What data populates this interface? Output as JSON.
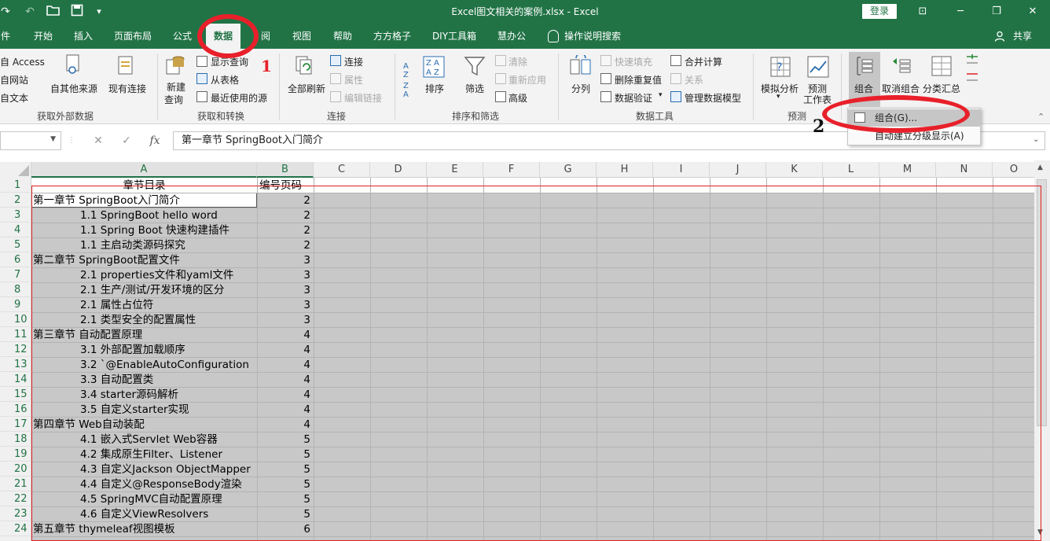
{
  "window": {
    "title": "Excel图文相关的案例.xlsx  -  Excel",
    "login_label": "登录",
    "min_glyph": "─",
    "max_glyph": "❐",
    "close_glyph": "✕",
    "ribbon_display_glyph": "⊡"
  },
  "qat": {
    "redo_glyph": "↷",
    "undo_glyph": "↶",
    "open_glyph": "▭",
    "save_glyph": "▣",
    "customize_glyph": "▾"
  },
  "tabs": [
    {
      "label": "件"
    },
    {
      "label": "开始"
    },
    {
      "label": "插入"
    },
    {
      "label": "页面布局"
    },
    {
      "label": "公式"
    },
    {
      "label": "数据"
    },
    {
      "label": "阅"
    },
    {
      "label": "视图"
    },
    {
      "label": "帮助"
    },
    {
      "label": "方方格子"
    },
    {
      "label": "DIY工具箱"
    },
    {
      "label": "慧办公"
    }
  ],
  "tell_me": "操作说明搜索",
  "share_label": "共享",
  "ribbon": {
    "get_external": {
      "from_access": "自 Access",
      "from_web": "自网站",
      "from_text": "自文本",
      "from_other": "自其他来源",
      "existing": "现有连接",
      "group": "获取外部数据"
    },
    "get_transform": {
      "new_query_1": "新建",
      "new_query_2": "查询",
      "show_queries": "显示查询",
      "from_table": "从表格",
      "recent_sources": "最近使用的源",
      "group": "获取和转换"
    },
    "connections": {
      "refresh_all": "全部刷新",
      "connections": "连接",
      "properties": "属性",
      "edit_links": "编辑链接",
      "group": "连接"
    },
    "sort_filter": {
      "sort": "排序",
      "filter": "筛选",
      "clear": "清除",
      "reapply": "重新应用",
      "advanced": "高级",
      "group": "排序和筛选"
    },
    "data_tools": {
      "split": "分列",
      "flash_fill": "快速填充",
      "remove_dup": "删除重复值",
      "validation": "数据验证",
      "consolidate": "合并计算",
      "relationships": "关系",
      "data_model": "管理数据模型",
      "group": "数据工具"
    },
    "forecast": {
      "what_if": "模拟分析",
      "forecast_sheet_1": "预测",
      "forecast_sheet_2": "工作表",
      "group": "预测"
    },
    "outline": {
      "group_btn": "组合",
      "ungroup": "取消组合",
      "subtotal": "分类汇总"
    }
  },
  "dropdown": {
    "item1": "组合(G)...",
    "item2": "自动建立分级显示(A)"
  },
  "formula_bar": {
    "cancel_glyph": "✕",
    "enter_glyph": "✓",
    "fx_glyph": "fx",
    "value": "第一章节  SpringBoot入门简介"
  },
  "columns": [
    "A",
    "B",
    "C",
    "D",
    "E",
    "F",
    "G",
    "H",
    "I",
    "J",
    "K",
    "L",
    "M",
    "N",
    "O"
  ],
  "rows": [
    {
      "n": "1",
      "a": "章节目录",
      "b": "编号页码"
    },
    {
      "n": "2",
      "a": "第一章节  SpringBoot入门简介",
      "b": "2"
    },
    {
      "n": "3",
      "a": "1.1   SpringBoot  hello word",
      "b": "2"
    },
    {
      "n": "4",
      "a": "1.1   Spring Boot 快速构建插件",
      "b": "2"
    },
    {
      "n": "5",
      "a": "1.1    主启动类源码探究",
      "b": "2"
    },
    {
      "n": "6",
      "a": "第二章节   SpringBoot配置文件",
      "b": "3"
    },
    {
      "n": "7",
      "a": "2.1    properties文件和yaml文件",
      "b": "3"
    },
    {
      "n": "8",
      "a": "2.1   生产/测试/开发环境的区分",
      "b": "3"
    },
    {
      "n": "9",
      "a": "2.1   属性占位符",
      "b": "3"
    },
    {
      "n": "10",
      "a": "2.1   类型安全的配置属性",
      "b": "3"
    },
    {
      "n": "11",
      "a": "第三章节   自动配置原理",
      "b": "4"
    },
    {
      "n": "12",
      "a": "3.1    外部配置加载顺序",
      "b": "4"
    },
    {
      "n": "13",
      "a": "3.2  `@EnableAutoConfiguration",
      "b": "4"
    },
    {
      "n": "14",
      "a": "3.3   自动配置类",
      "b": "4"
    },
    {
      "n": "15",
      "a": "3.4   starter源码解析",
      "b": "4"
    },
    {
      "n": "16",
      "a": "3.5   自定义starter实现",
      "b": "4"
    },
    {
      "n": "17",
      "a": "第四章节  Web自动装配",
      "b": "4"
    },
    {
      "n": "18",
      "a": "4.1  嵌入式Servlet Web容器",
      "b": "5"
    },
    {
      "n": "19",
      "a": "4.2  集成原生Filter、Listener",
      "b": "5"
    },
    {
      "n": "20",
      "a": "4.3 自定义Jackson ObjectMapper",
      "b": "5"
    },
    {
      "n": "21",
      "a": "4.4  自定义@ResponseBody渲染",
      "b": "5"
    },
    {
      "n": "22",
      "a": "4.5  SpringMVC自动配置原理",
      "b": "5"
    },
    {
      "n": "23",
      "a": "4.6  自定义ViewResolvers",
      "b": "5"
    },
    {
      "n": "24",
      "a": "第五章节   thymeleaf视图模板",
      "b": "6"
    }
  ],
  "annotations": {
    "step1": "1",
    "step2": "2"
  },
  "colors": {
    "excel_green": "#217346",
    "annotation_red": "#e8202a",
    "selection_gray": "#c8c8c8"
  }
}
